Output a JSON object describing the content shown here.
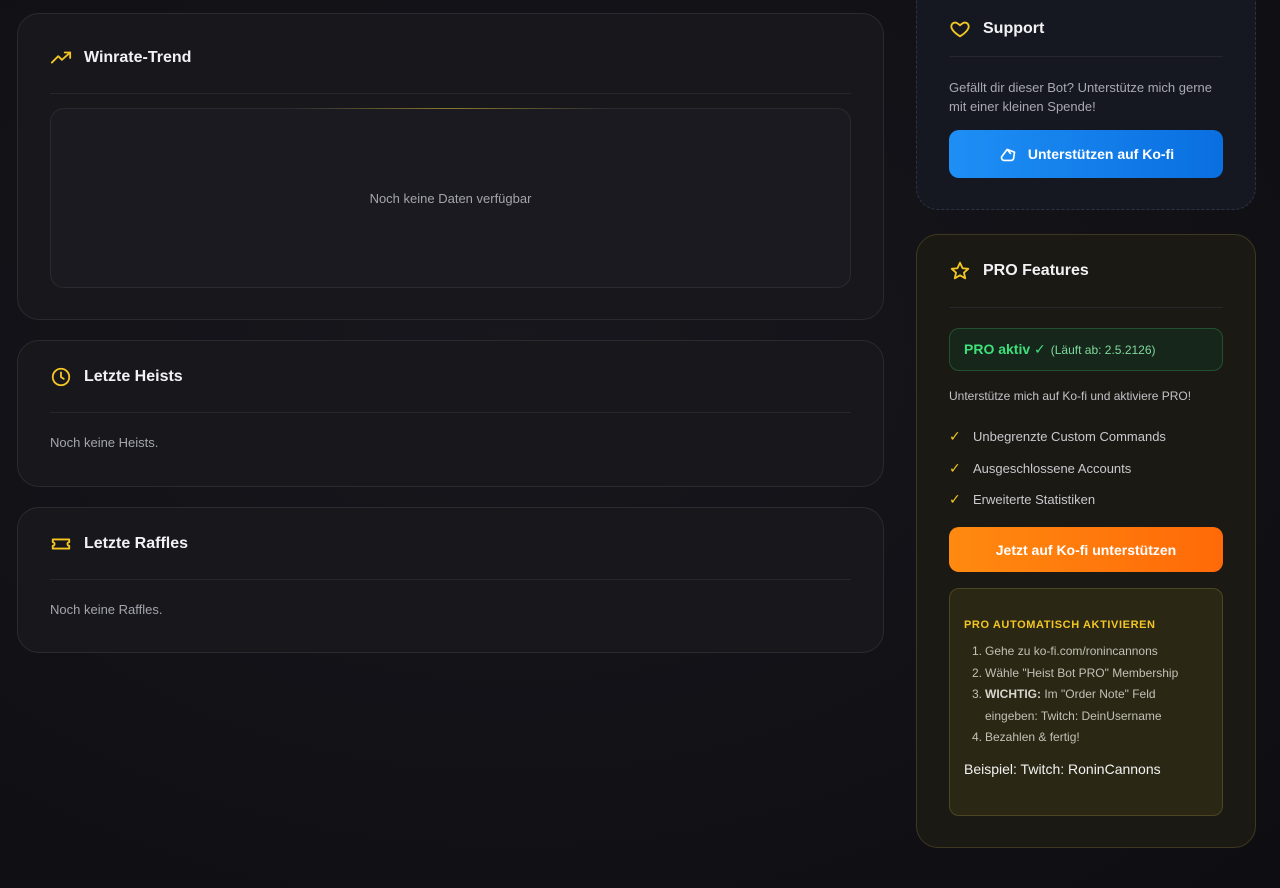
{
  "winrate": {
    "title": "Winrate-Trend",
    "icon": "trending-up-icon",
    "empty_text": "Noch keine Daten verfügbar"
  },
  "heists": {
    "title": "Letzte Heists",
    "icon": "clock-icon",
    "empty_text": "Noch keine Heists."
  },
  "raffles": {
    "title": "Letzte Raffles",
    "icon": "ticket-icon",
    "empty_text": "Noch keine Raffles."
  },
  "support": {
    "title": "Support",
    "icon": "heart-icon",
    "text": "Gefällt dir dieser Bot? Unterstütze mich gerne mit einer kleinen Spende!",
    "button_label": "Unterstützen auf Ko-fi",
    "button_icon": "kofi-cup-icon"
  },
  "pro": {
    "title": "PRO Features",
    "icon": "star-icon",
    "status_label": "PRO aktiv ✓",
    "status_expiry": "(Läuft ab: 2.5.2126)",
    "intro": "Unterstütze mich auf Ko-fi und aktiviere PRO!",
    "features": [
      "Unbegrenzte Custom Commands",
      "Ausgeschlossene Accounts",
      "Erweiterte Statistiken"
    ],
    "cta_label": "Jetzt auf Ko-fi unterstützen",
    "auto": {
      "title": "PRO AUTOMATISCH AKTIVIEREN",
      "steps": [
        {
          "num": "1.",
          "bold": "",
          "text": "Gehe zu ko-fi.com/ronincannons"
        },
        {
          "num": "2.",
          "bold": "",
          "text": "Wähle \"Heist Bot PRO\" Membership"
        },
        {
          "num": "3.",
          "bold": "WICHTIG:",
          "text": " Im \"Order Note\" Feld eingeben: Twitch: DeinUsername"
        },
        {
          "num": "4.",
          "bold": "",
          "text": "Bezahlen & fertig!"
        }
      ],
      "example": "Beispiel: Twitch: RoninCannons"
    }
  },
  "colors": {
    "accent_yellow": "#f3c623",
    "kofi_blue": "#1e8ff5",
    "kofi_orange": "#ff7a0c",
    "pro_green": "#3ee07a"
  }
}
